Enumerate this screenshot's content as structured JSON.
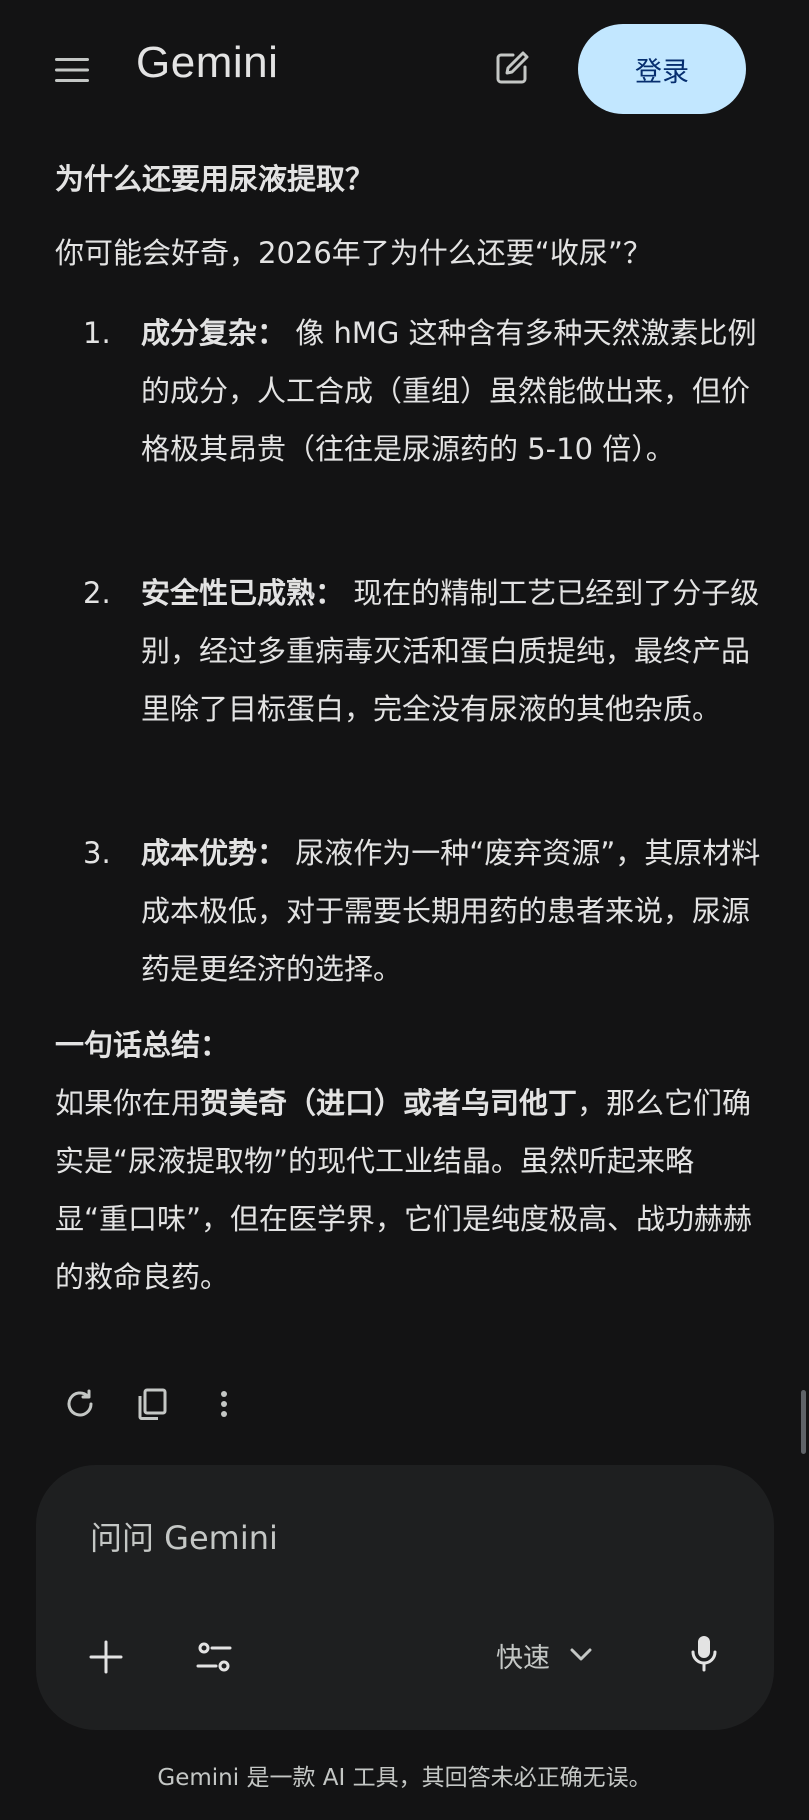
{
  "header": {
    "title": "Gemini",
    "login_label": "登录"
  },
  "article": {
    "heading": "为什么还要用尿液提取？",
    "intro": "你可能会好奇，2026年了为什么还要“收尿”？",
    "items": [
      {
        "number": "1.",
        "label": "成分复杂：",
        "text": " 像 hMG 这种含有多种天然激素比例的成分，人工合成（重组）虽然能做出来，但价格极其昂贵（往往是尿源药的 5-10 倍）。"
      },
      {
        "number": "2.",
        "label": "安全性已成熟：",
        "text": " 现在的精制工艺已经到了分子级别，经过多重病毒灭活和蛋白质提纯，最终产品里除了目标蛋白，完全没有尿液的其他杂质。"
      },
      {
        "number": "3.",
        "label": "成本优势：",
        "text": " 尿液作为一种“废弃资源”，其原材料成本极低，对于需要长期用药的患者来说，尿源药是更经济的选择。"
      }
    ],
    "summary": {
      "title": "一句话总结：",
      "text_1": "如果你在用",
      "bold": "贺美奇（进口）或者乌司他丁",
      "text_2": "，那么它们确实是“尿液提取物”的现代工业结晶。虽然听起来略显“重口味”，但在医学界，它们是纯度极高、战功赫赫的救命良药。"
    }
  },
  "response_actions": {
    "icons": [
      "refresh-icon",
      "copy-icon",
      "more-vert-icon"
    ]
  },
  "composer": {
    "placeholder": "问问 Gemini",
    "mode_label": "快速"
  },
  "footer": {
    "disclaimer": "Gemini 是一款 AI 工具，其回答未必正确无误。"
  },
  "colors": {
    "background": "#131314",
    "text": "#e3e3e3",
    "login_bg": "#c2e7ff",
    "composer_bg": "#1e1f20"
  }
}
